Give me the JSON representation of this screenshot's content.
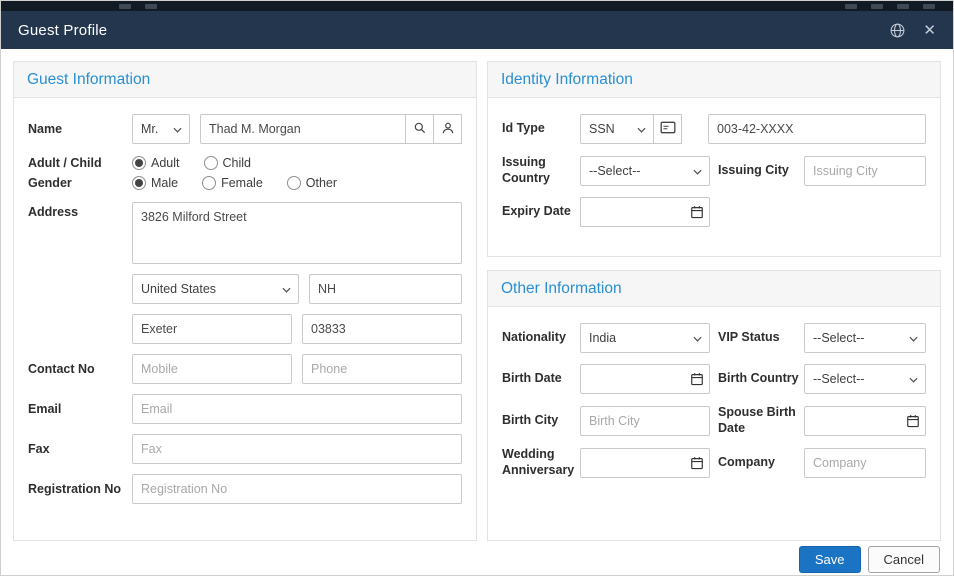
{
  "modal": {
    "title": "Guest Profile"
  },
  "icons": {
    "close_glyph": "✕",
    "globe": "globe-icon",
    "search": "search-icon",
    "user": "user-icon",
    "id_card": "id-card-icon",
    "calendar": "calendar-icon",
    "chevron": "chevron-down-icon"
  },
  "colors": {
    "header_bg": "#24364e",
    "section_title": "#2a8fd2",
    "save_button": "#1b73c4"
  },
  "guest": {
    "section_title": "Guest Information",
    "name_label": "Name",
    "title_value": "Mr.",
    "name_value": "Thad M. Morgan",
    "adult_child_label": "Adult / Child",
    "adult_label": "Adult",
    "child_label": "Child",
    "adult_child_value": "Adult",
    "gender_label": "Gender",
    "male_label": "Male",
    "female_label": "Female",
    "other_label": "Other",
    "gender_value": "Male",
    "address_label": "Address",
    "address_value": "3826 Milford Street",
    "country_value": "United States",
    "state_value": "NH",
    "city_value": "Exeter",
    "zip_value": "03833",
    "contact_label": "Contact No",
    "mobile_placeholder": "Mobile",
    "phone_placeholder": "Phone",
    "email_label": "Email",
    "email_placeholder": "Email",
    "fax_label": "Fax",
    "fax_placeholder": "Fax",
    "registration_label": "Registration No",
    "registration_placeholder": "Registration No"
  },
  "identity": {
    "section_title": "Identity Information",
    "id_type_label": "Id Type",
    "id_type_value": "SSN",
    "id_number_value": "003-42-XXXX",
    "issuing_country_label": "Issuing Country",
    "issuing_country_value": "--Select--",
    "issuing_city_label": "Issuing City",
    "issuing_city_placeholder": "Issuing City",
    "expiry_date_label": "Expiry Date"
  },
  "other": {
    "section_title": "Other Information",
    "nationality_label": "Nationality",
    "nationality_value": "India",
    "vip_status_label": "VIP Status",
    "vip_status_value": "--Select--",
    "birth_date_label": "Birth Date",
    "birth_country_label": "Birth Country",
    "birth_country_value": "--Select--",
    "birth_city_label": "Birth City",
    "birth_city_placeholder": "Birth City",
    "spouse_birth_date_label": "Spouse Birth Date",
    "wedding_anniversary_label": "Wedding Anniversary",
    "company_label": "Company",
    "company_placeholder": "Company"
  },
  "footer": {
    "save_label": "Save",
    "cancel_label": "Cancel"
  }
}
